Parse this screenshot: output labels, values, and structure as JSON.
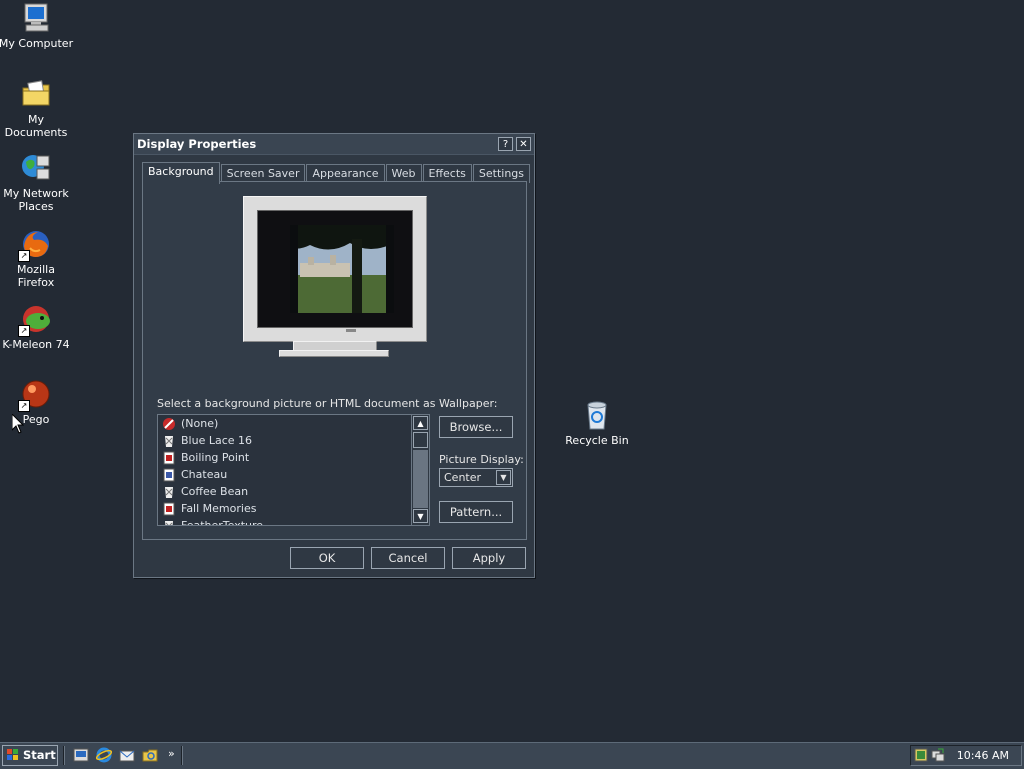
{
  "desktop": {
    "icons": [
      {
        "label": "My Computer"
      },
      {
        "label": "My Documents"
      },
      {
        "label": "My Network Places"
      },
      {
        "label": "Mozilla Firefox"
      },
      {
        "label": "K-Meleon 74"
      },
      {
        "label": "Pego"
      },
      {
        "label": "Recycle Bin"
      }
    ]
  },
  "dialog": {
    "title": "Display Properties",
    "help_glyph": "?",
    "close_glyph": "✕",
    "tabs": [
      {
        "label": "Background"
      },
      {
        "label": "Screen Saver"
      },
      {
        "label": "Appearance"
      },
      {
        "label": "Web"
      },
      {
        "label": "Effects"
      },
      {
        "label": "Settings"
      }
    ],
    "active_tab": "Background",
    "instruction": "Select a background picture or HTML document as Wallpaper:",
    "wallpapers": [
      {
        "label": "(None)",
        "icon": "none-icon"
      },
      {
        "label": "Blue Lace 16",
        "icon": "bmp-file-icon"
      },
      {
        "label": "Boiling Point",
        "icon": "html-file-icon"
      },
      {
        "label": "Chateau",
        "icon": "jpg-file-icon"
      },
      {
        "label": "Coffee Bean",
        "icon": "bmp-file-icon"
      },
      {
        "label": "Fall Memories",
        "icon": "html-file-icon"
      },
      {
        "label": "FeatherTexture",
        "icon": "bmp-file-icon"
      }
    ],
    "browse_label": "Browse...",
    "picture_display_label": "Picture Display:",
    "picture_display_value": "Center",
    "pattern_label": "Pattern...",
    "ok_label": "OK",
    "cancel_label": "Cancel",
    "apply_label": "Apply"
  },
  "taskbar": {
    "start_label": "Start",
    "overflow_glyph": "»",
    "clock": "10:46 AM"
  },
  "colors": {
    "desktop": "#232a34",
    "dialog": "#2f3843",
    "border": "#9aa5b1"
  }
}
